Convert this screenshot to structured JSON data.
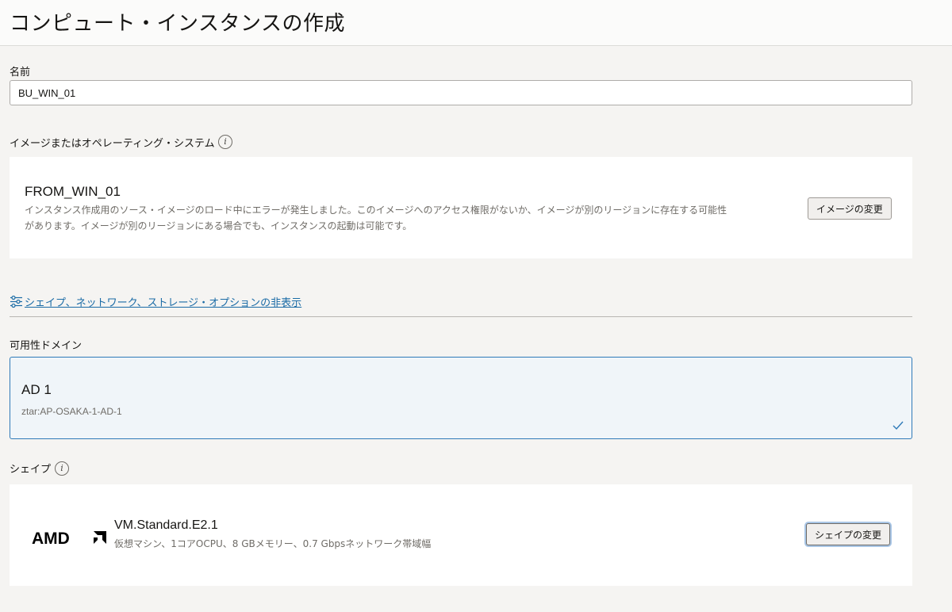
{
  "header": {
    "title": "コンピュート・インスタンスの作成"
  },
  "name_field": {
    "label": "名前",
    "value": "BU_WIN_01"
  },
  "image_section": {
    "label": "イメージまたはオペレーティング・システム",
    "image_name": "FROM_WIN_01",
    "error_line1": "インスタンス作成用のソース・イメージのロード中にエラーが発生しました。このイメージへのアクセス権限がないか、イメージが別のリージョンに存在する可能性",
    "error_line2": "があります。イメージが別のリージョンにある場合でも、インスタンスの起動は可能です。",
    "change_button": "イメージの変更"
  },
  "toggle_link": {
    "label": "シェイプ、ネットワーク、ストレージ・オプションの非表示"
  },
  "availability_domain": {
    "label": "可用性ドメイン",
    "name": "AD 1",
    "id": "ztar:AP-OSAKA-1-AD-1"
  },
  "shape_section": {
    "label": "シェイプ",
    "vendor_logo": "AMD",
    "shape_name": "VM.Standard.E2.1",
    "shape_desc": "仮想マシン、1コアOCPU、8 GBメモリー、0.7 Gbpsネットワーク帯域幅",
    "change_button": "シェイプの変更"
  },
  "colors": {
    "link": "#1a6ba6",
    "selected_border": "#2f7ab8",
    "selected_bg": "#f0f5f9"
  }
}
